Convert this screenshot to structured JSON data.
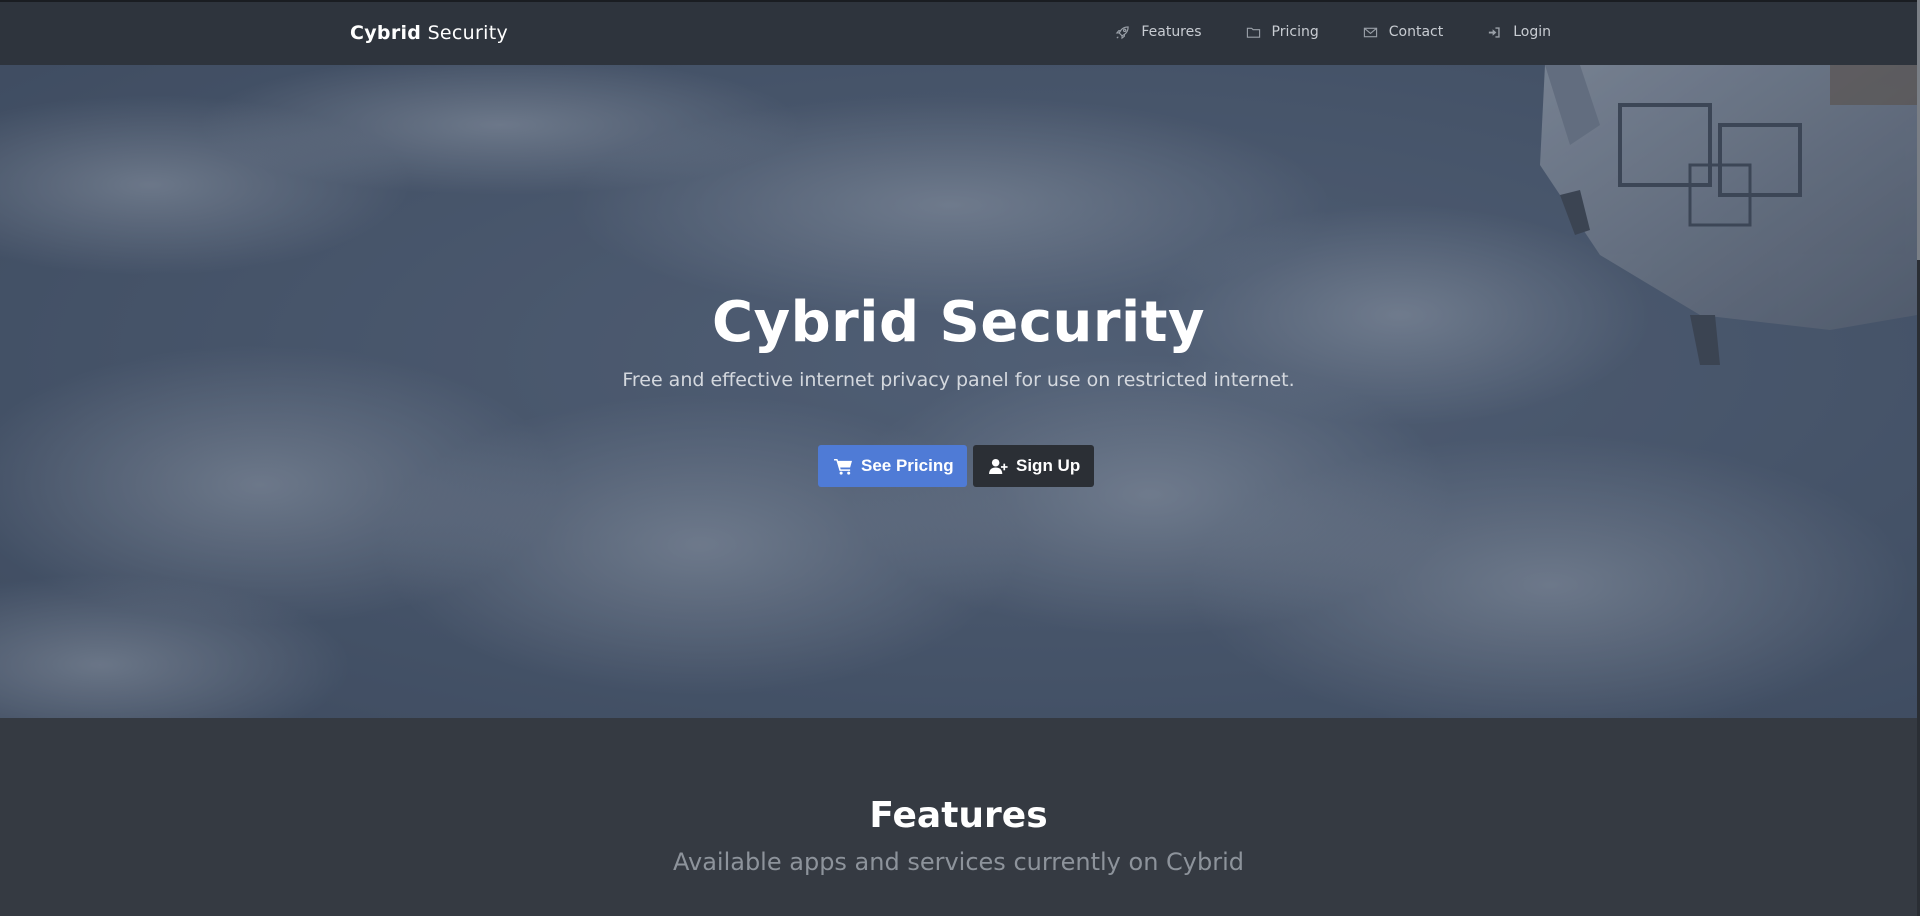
{
  "navbar": {
    "brand_bold": "Cybrid",
    "brand_light": "Security",
    "links": [
      {
        "label": "Features",
        "icon": "rocket-icon"
      },
      {
        "label": "Pricing",
        "icon": "folder-icon"
      },
      {
        "label": "Contact",
        "icon": "envelope-icon"
      },
      {
        "label": "Login",
        "icon": "sign-in-icon"
      }
    ]
  },
  "hero": {
    "title": "Cybrid Security",
    "subtitle": "Free and effective internet privacy panel for use on restricted internet.",
    "buttons": {
      "pricing": {
        "label": "See Pricing",
        "icon": "cart-icon",
        "color": "#4f7bd6"
      },
      "signup": {
        "label": "Sign Up",
        "icon": "user-plus-icon",
        "color": "#2b2f35"
      }
    }
  },
  "features": {
    "title": "Features",
    "subtitle": "Available apps and services currently on Cybrid"
  },
  "colors": {
    "navbar_bg": "#2e343d",
    "section_bg": "#353a42",
    "accent": "#4f7bd6"
  }
}
